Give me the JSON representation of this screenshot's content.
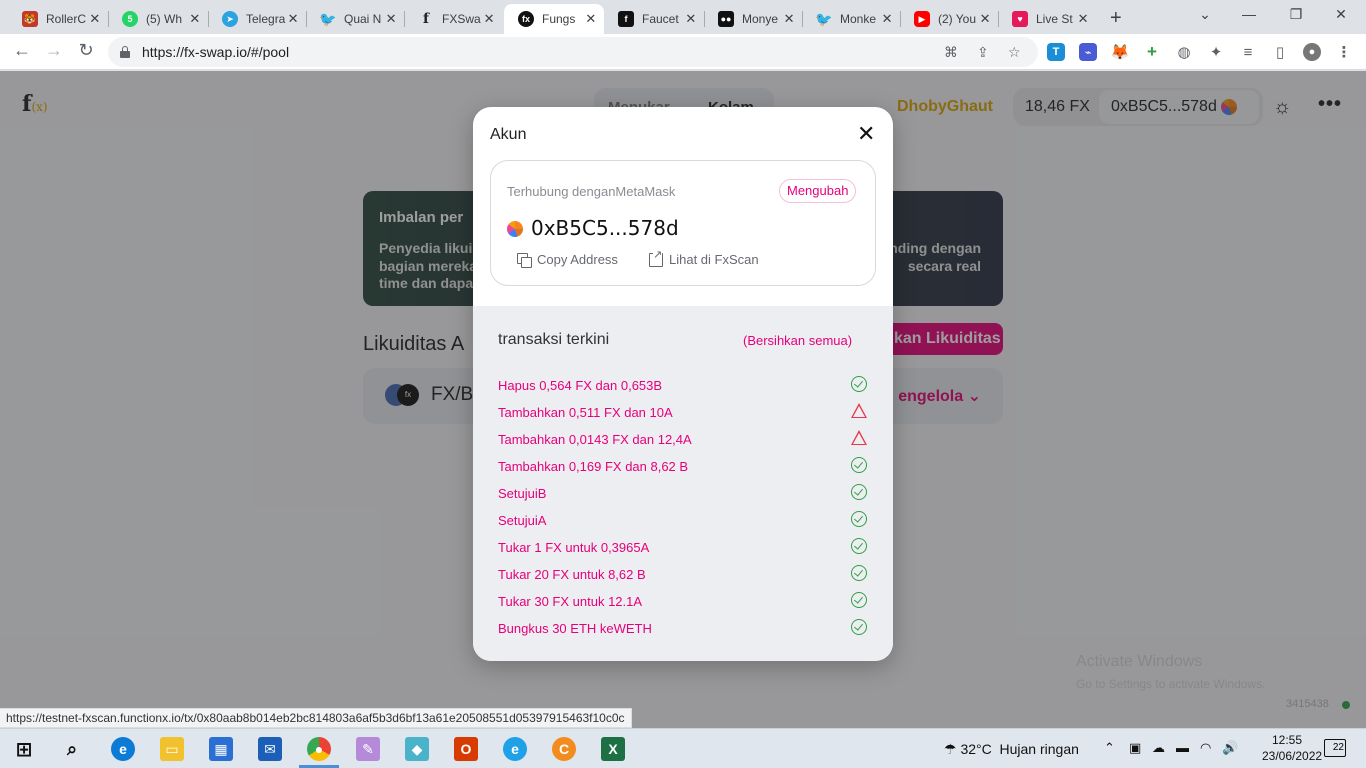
{
  "browser": {
    "tabs": [
      {
        "label": "RollerC",
        "fav_color": "#c0392b"
      },
      {
        "label": "(5) Wh",
        "fav_color": "#25d366",
        "fav_text": "5"
      },
      {
        "label": "Telegra",
        "fav_color": "#2aa3e0"
      },
      {
        "label": "Quai N",
        "fav_color": "#1da1f2"
      },
      {
        "label": "FXSwa",
        "fav_color": "#ffffff"
      },
      {
        "label": "Fungs",
        "fav_color": "#111111",
        "active": true
      },
      {
        "label": "Faucet",
        "fav_color": "#111111"
      },
      {
        "label": "Monye",
        "fav_color": "#111111"
      },
      {
        "label": "Monke",
        "fav_color": "#1da1f2"
      },
      {
        "label": "(2) You",
        "fav_color": "#ff0000"
      },
      {
        "label": "Live St",
        "fav_color": "#e6195a"
      }
    ],
    "url": "https://fx-swap.io/#/pool",
    "status_url": "https://testnet-fxscan.functionx.io/tx/0x80aab8b014eb2bc814803a6af5b3d6bf13a61e20508551d05397915463f10c0c"
  },
  "app": {
    "logo": "f",
    "logo_sub": "(x)",
    "nav": [
      "Menukar",
      "Kolam"
    ],
    "network": "DhobyGhaut",
    "balance": "18,46 FX",
    "address_short": "0xB5C5...578d",
    "banner_title": "Imbalan per",
    "banner_left_lines": [
      "Penyedia likui",
      "bagian mereka",
      "time dan dapa"
    ],
    "banner_right_lines": [
      "nding dengan",
      "secara real"
    ],
    "liquidity_title": "Likuiditas A",
    "add_liquidity_label": "kan Likuiditas",
    "pool_name": "FX/B",
    "manage_label": "engelola",
    "block_number": "3415438",
    "activate_line1": "Activate Windows",
    "activate_line2": "Go to Settings to activate Windows."
  },
  "modal": {
    "title": "Akun",
    "connected_text": "Terhubung denganMetaMask",
    "change_label": "Mengubah",
    "address": "0xB5C5...578d",
    "copy_label": "Copy Address",
    "view_label": "Lihat di FxScan",
    "recent_title": "transaksi terkini",
    "clear_label": "(Bersihkan semua)",
    "transactions": [
      {
        "label": "Hapus 0,564 FX dan 0,653B",
        "status": "success"
      },
      {
        "label": "Tambahkan 0,511 FX dan 10A",
        "status": "failed"
      },
      {
        "label": "Tambahkan 0,0143 FX dan 12,4A",
        "status": "failed"
      },
      {
        "label": "Tambahkan 0,169 FX dan 8,62 B",
        "status": "success"
      },
      {
        "label": "SetujuiB",
        "status": "success"
      },
      {
        "label": "SetujuiA",
        "status": "success"
      },
      {
        "label": "Tukar 1 FX untuk 0,3965A",
        "status": "success"
      },
      {
        "label": "Tukar 20 FX untuk 8,62 B",
        "status": "success"
      },
      {
        "label": "Tukar 30 FX untuk 12.1A",
        "status": "success"
      },
      {
        "label": "Bungkus 30 ETH keWETH",
        "status": "success"
      }
    ]
  },
  "taskbar": {
    "temperature": "32°C",
    "weather": "Hujan ringan",
    "time": "12:55",
    "date": "23/06/2022",
    "notifications": "22"
  },
  "colors": {
    "accent": "#e6007a",
    "network": "#d9a400",
    "success": "#2ea043",
    "failed": "#e8384f"
  }
}
